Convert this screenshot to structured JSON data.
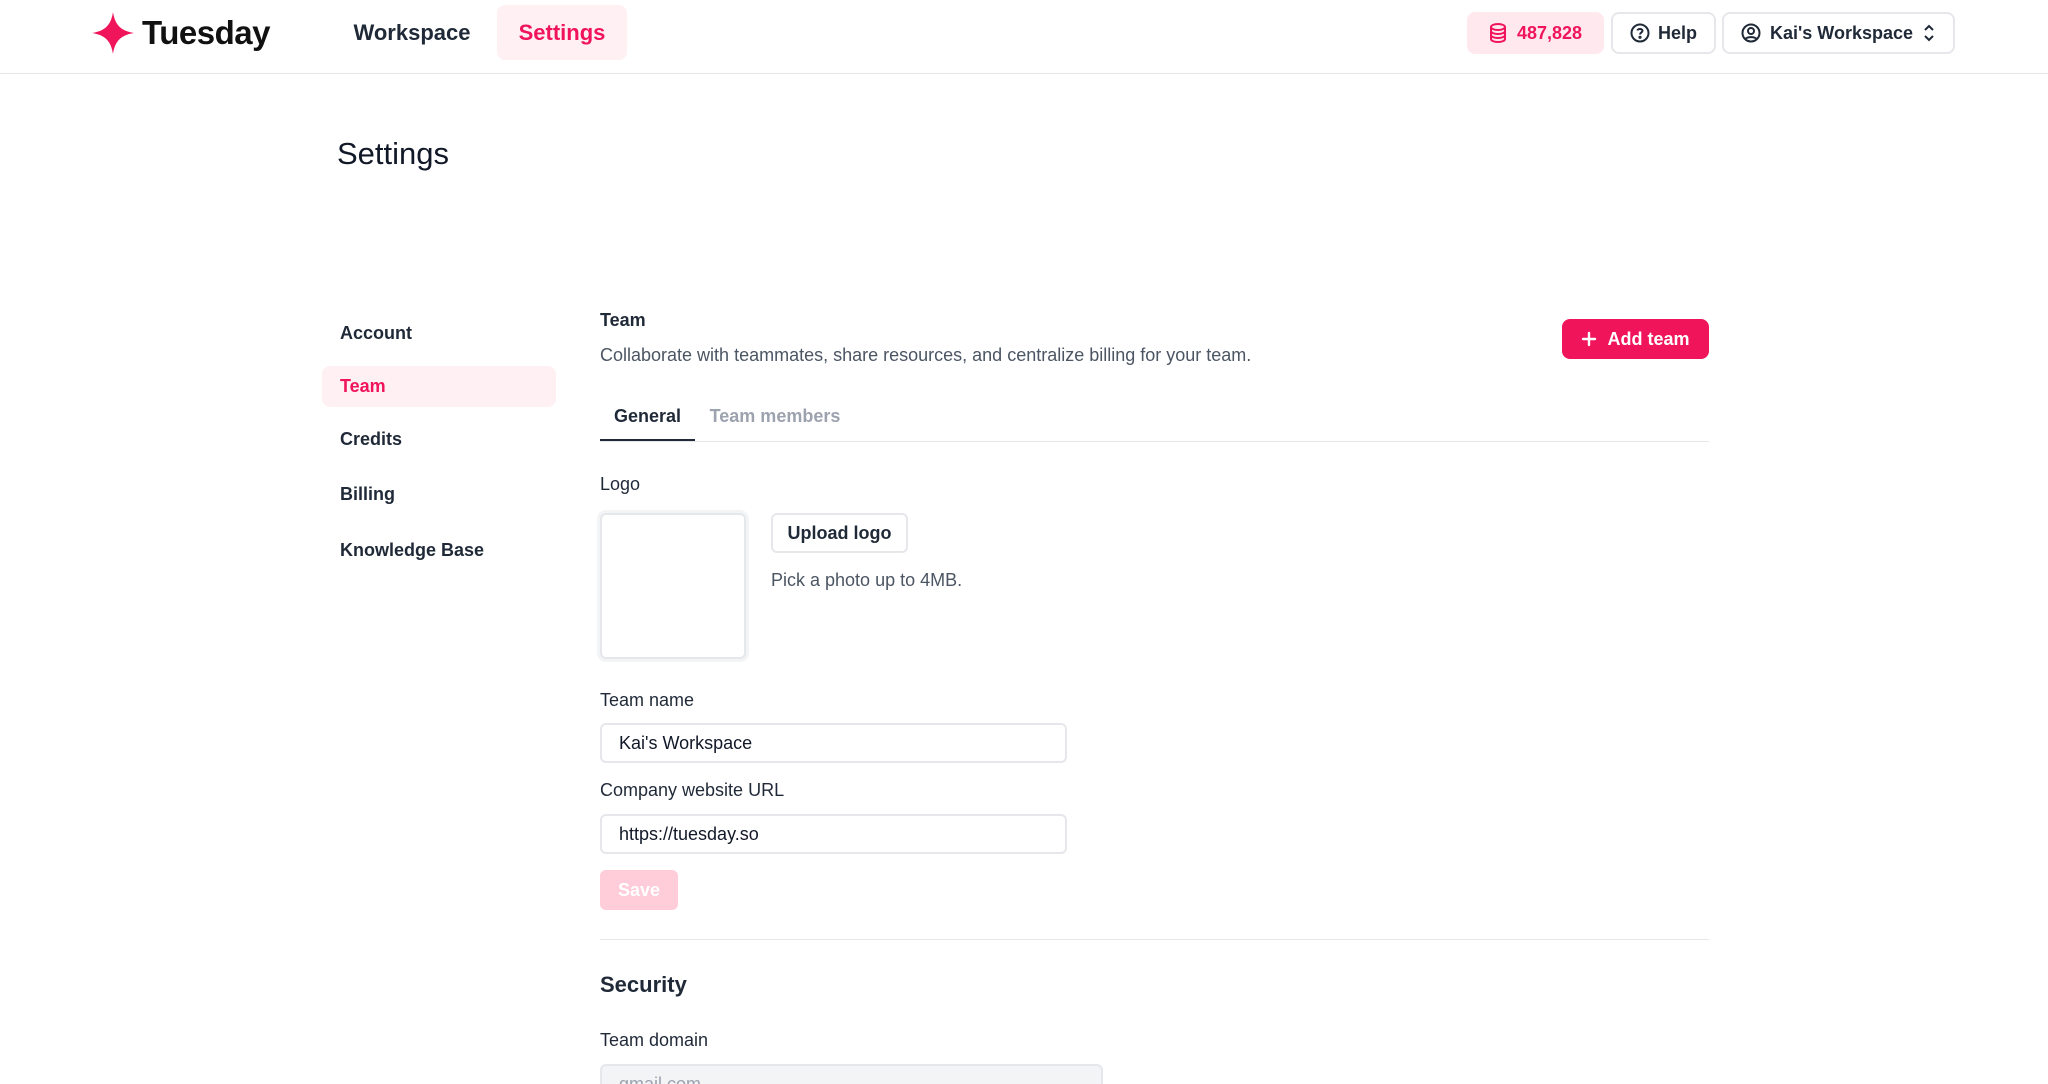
{
  "brand": {
    "name": "Tuesday",
    "accent": "#f0145a"
  },
  "nav": {
    "workspace": "Workspace",
    "settings": "Settings"
  },
  "topbar": {
    "credits": "487,828",
    "help": "Help",
    "workspace_switcher": "Kai's Workspace"
  },
  "page": {
    "title": "Settings"
  },
  "sidebar": {
    "items": [
      {
        "label": "Account"
      },
      {
        "label": "Team"
      },
      {
        "label": "Credits"
      },
      {
        "label": "Billing"
      },
      {
        "label": "Knowledge Base"
      }
    ],
    "active": "Team"
  },
  "team": {
    "label": "Team",
    "description": "Collaborate with teammates, share resources, and centralize billing for your team.",
    "add_button": "Add team",
    "tabs": [
      {
        "label": "General"
      },
      {
        "label": "Team members"
      }
    ],
    "active_tab": "General",
    "logo": {
      "label": "Logo",
      "upload_button": "Upload logo",
      "hint": "Pick a photo up to 4MB."
    },
    "team_name": {
      "label": "Team name",
      "value": "Kai's Workspace"
    },
    "website": {
      "label": "Company website URL",
      "value": "https://tuesday.so"
    },
    "save_button": "Save"
  },
  "security": {
    "title": "Security",
    "team_domain": {
      "label": "Team domain",
      "value": "gmail.com"
    }
  },
  "icons": {
    "logo": "sparkle-icon",
    "credits": "database-icon",
    "help": "help-circle-icon",
    "workspace": "user-circle-icon",
    "switcher": "chevron-up-down-icon",
    "add": "plus-icon"
  }
}
